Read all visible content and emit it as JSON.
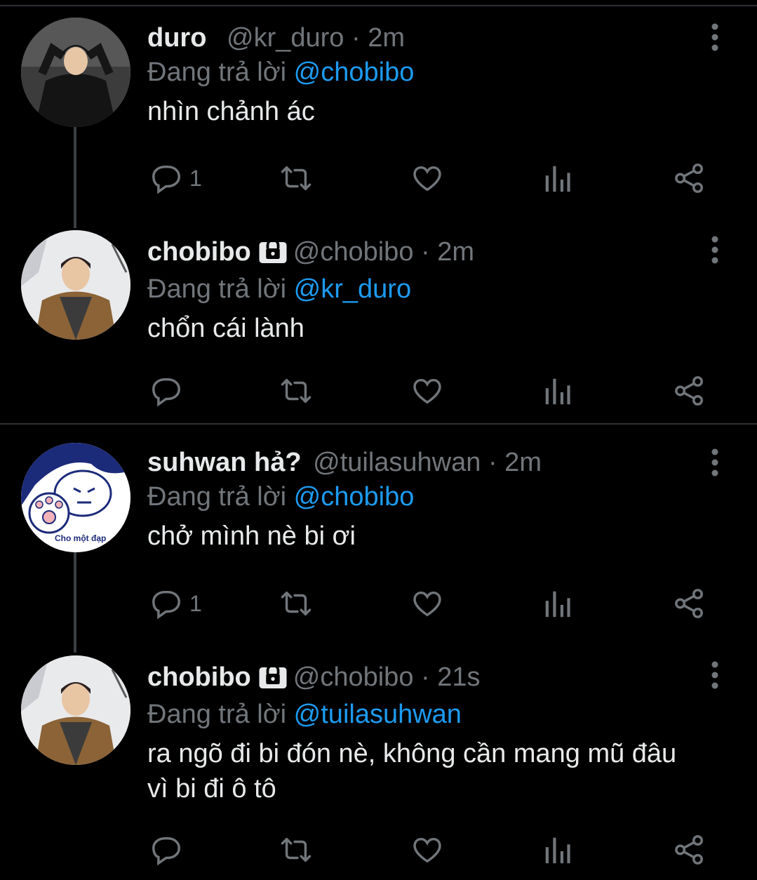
{
  "tweets": [
    {
      "name": "duro",
      "handle": "@kr_duro",
      "time": "· 2m",
      "locked": false,
      "reply_prefix": "Đang trả lời ",
      "reply_to": "@chobibo",
      "text": "nhìn chảnh ác",
      "reply_count": "1",
      "avatar": "person-dark-jacket"
    },
    {
      "name": "chobibo",
      "handle": "@chobibo",
      "time": "· 2m",
      "locked": true,
      "reply_prefix": "Đang trả lời ",
      "reply_to": "@kr_duro",
      "text": "chổn cái lành",
      "reply_count": "",
      "avatar": "person-brown-coat-snow"
    },
    {
      "name": "suhwan hả?",
      "handle": "@tuilasuhwan",
      "time": "· 2m",
      "locked": false,
      "reply_prefix": "Đang trả lời ",
      "reply_to": "@chobibo",
      "text": "chở mình nè bi ơi",
      "reply_count": "1",
      "avatar": "cartoon-cat-paw",
      "avatar_caption": "Cho một đạp"
    },
    {
      "name": "chobibo",
      "handle": "@chobibo",
      "time": "· 21s",
      "locked": true,
      "reply_prefix": "Đang trả lời ",
      "reply_to": "@tuilasuhwan",
      "text_line1": "ra ngõ đi bi đón nè, không cần mang mũ đâu",
      "text_line2": "vì bi đi ô tô",
      "reply_count": "",
      "avatar": "person-brown-coat-snow"
    }
  ],
  "icons": [
    "reply-icon",
    "retweet-icon",
    "like-icon",
    "analytics-icon",
    "share-icon",
    "more-icon",
    "lock-icon"
  ],
  "colors": {
    "background": "#000000",
    "text": "#e7e9ea",
    "muted": "#71767b",
    "accent": "#1d9bf0",
    "divider": "#2f3336"
  }
}
